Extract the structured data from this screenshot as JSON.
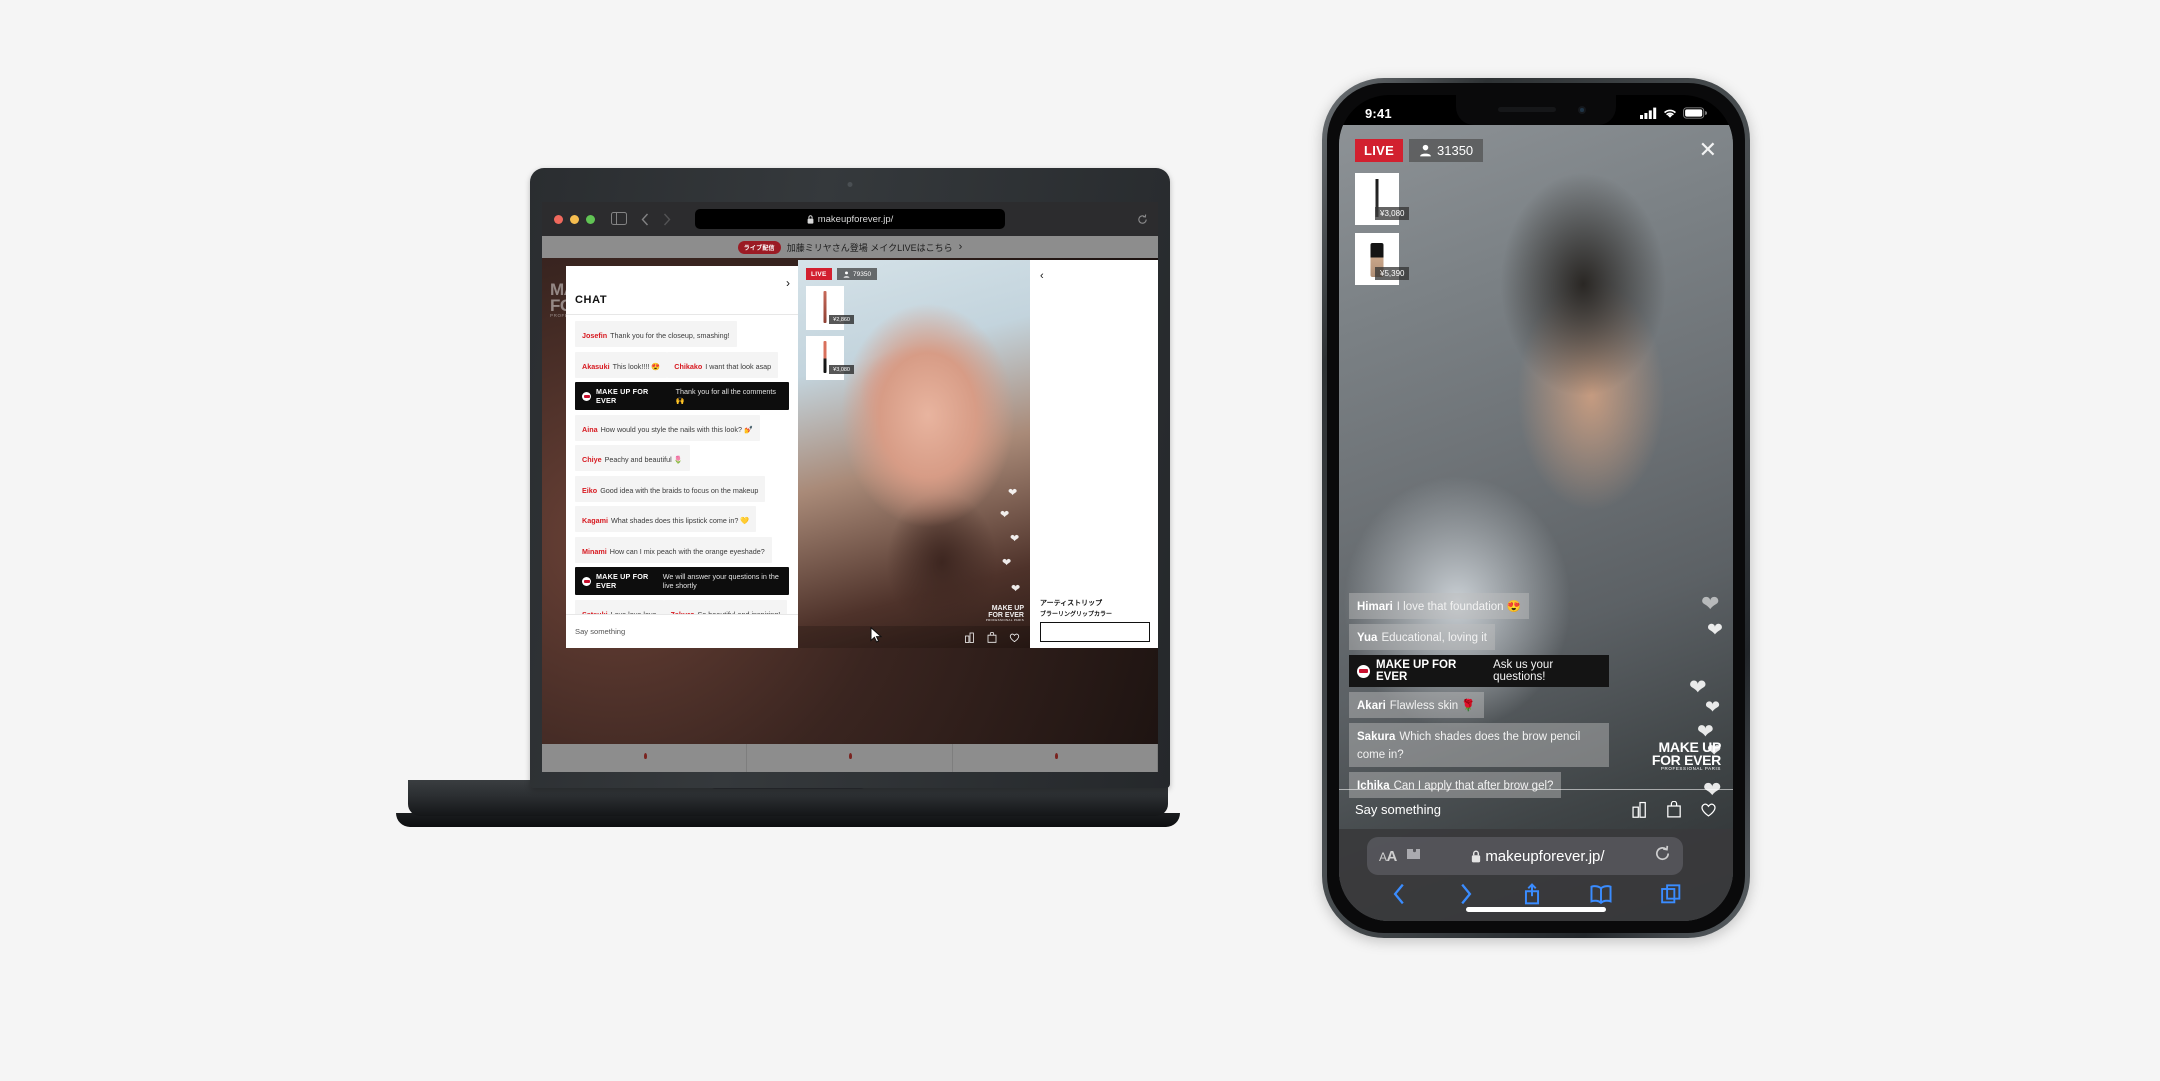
{
  "laptop": {
    "browser": {
      "url": "makeupforever.jp/",
      "lock_icon": "lock-icon",
      "reload_icon": "reload-icon",
      "sidebar_icon": "sidebar-icon",
      "back_icon": "back-chevron-icon",
      "forward_icon": "forward-chevron-icon",
      "shield_icon": "privacy-shield-icon",
      "traffic_lights": [
        "close",
        "minimize",
        "zoom"
      ]
    },
    "promo": {
      "badge": "ライブ配信",
      "text": "加藤ミリヤさん登場 メイクLIVEはこちら",
      "chevron": "›"
    },
    "brand_logo": {
      "line1": "MAKE UP",
      "line2": "FOR EVER",
      "tagline": "PROFESSIONAL PARIS"
    },
    "chat": {
      "title": "CHAT",
      "collapse_icon": "chevron-right-icon",
      "input_placeholder": "Say something",
      "messages": [
        {
          "user": "Josefin",
          "text": "Thank you for the closeup, smashing!",
          "brand": false
        },
        {
          "user": "Akasuki",
          "text": "This look!!!! 😍",
          "brand": false
        },
        {
          "user": "Chikako",
          "text": "I want that look asap",
          "brand": false
        },
        {
          "user": "MAKE UP FOR EVER",
          "text": "Thank you for all the comments 🙌",
          "brand": true
        },
        {
          "user": "Aina",
          "text": "How would you style the nails with this look? 💅",
          "brand": false
        },
        {
          "user": "Chiye",
          "text": "Peachy and beautiful 🌷",
          "brand": false
        },
        {
          "user": "Eiko",
          "text": "Good idea with the braids to focus on the makeup",
          "brand": false
        },
        {
          "user": "Kagami",
          "text": "What shades does this lipstick come in? 💛",
          "brand": false
        },
        {
          "user": "Minami",
          "text": "How can I mix peach with the orange eyeshade?",
          "brand": false
        },
        {
          "user": "MAKE UP FOR EVER",
          "text": "We will answer your questions in the live shortly",
          "brand": true
        },
        {
          "user": "Satsuki",
          "text": "Love love love",
          "brand": false
        },
        {
          "user": "Zakuro",
          "text": "So beautiful and inspiring!",
          "brand": false
        }
      ]
    },
    "video": {
      "live_label": "LIVE",
      "viewers": "79350",
      "viewer_icon": "person-icon",
      "products": [
        {
          "price": "¥2,860",
          "name": "lip-pencil-thumbnail"
        },
        {
          "price": "¥3,080",
          "name": "lipstick-thumbnail"
        }
      ],
      "watermark": {
        "line1": "MAKE UP",
        "line2": "FOR EVER",
        "tagline": "PROFESSIONAL PARIS"
      },
      "actions": [
        "lipstick-icon",
        "shopping-bag-icon",
        "heart-icon"
      ]
    },
    "product_panel": {
      "back_icon": "chevron-left-icon",
      "title": "アーティストリップ",
      "subtitle": "ブラーリングリップカラー",
      "cta_label": ""
    }
  },
  "phone": {
    "status": {
      "time": "9:41",
      "cellular_icon": "cellular-bars-icon",
      "wifi_icon": "wifi-icon",
      "battery_icon": "battery-icon"
    },
    "live": {
      "live_label": "LIVE",
      "viewers": "31350",
      "viewer_icon": "person-icon",
      "close_icon": "close-x-icon",
      "products": [
        {
          "price": "¥3,080",
          "name": "brow-pencil-thumbnail"
        },
        {
          "price": "¥5,390",
          "name": "foundation-thumbnail"
        }
      ],
      "watermark": {
        "line1": "MAKE UP",
        "line2": "FOR EVER",
        "tagline": "PROFESSIONAL PARIS"
      },
      "messages": [
        {
          "user": "Himari",
          "text": "I love that foundation 😍",
          "brand": false
        },
        {
          "user": "Yua",
          "text": "Educational, loving it",
          "brand": false
        },
        {
          "user": "MAKE UP FOR EVER",
          "text": "Ask us your questions!",
          "brand": true
        },
        {
          "user": "Akari",
          "text": "Flawless skin 🌹",
          "brand": false
        },
        {
          "user": "Sakura",
          "text": "Which shades does the brow pencil come in?",
          "brand": false
        },
        {
          "user": "Ichika",
          "text": "Can I apply that after brow gel?",
          "brand": false
        }
      ],
      "input_placeholder": "Say something",
      "actions": [
        "lipstick-icon",
        "shopping-bag-icon",
        "heart-icon"
      ]
    },
    "safari": {
      "text_size_label": "AA",
      "extensions_icon": "puzzle-icon",
      "lock_icon": "lock-icon",
      "url": "makeupforever.jp/",
      "reload_icon": "reload-icon",
      "tabbar": [
        "back-icon",
        "forward-icon",
        "share-icon",
        "bookmarks-icon",
        "tabs-icon"
      ]
    }
  },
  "colors": {
    "live_red": "#d2202f",
    "brand_red": "#d71920",
    "promo_badge": "#9b1b24",
    "safari_blue": "#3a8cff",
    "page_bg": "#f5f5f5"
  }
}
